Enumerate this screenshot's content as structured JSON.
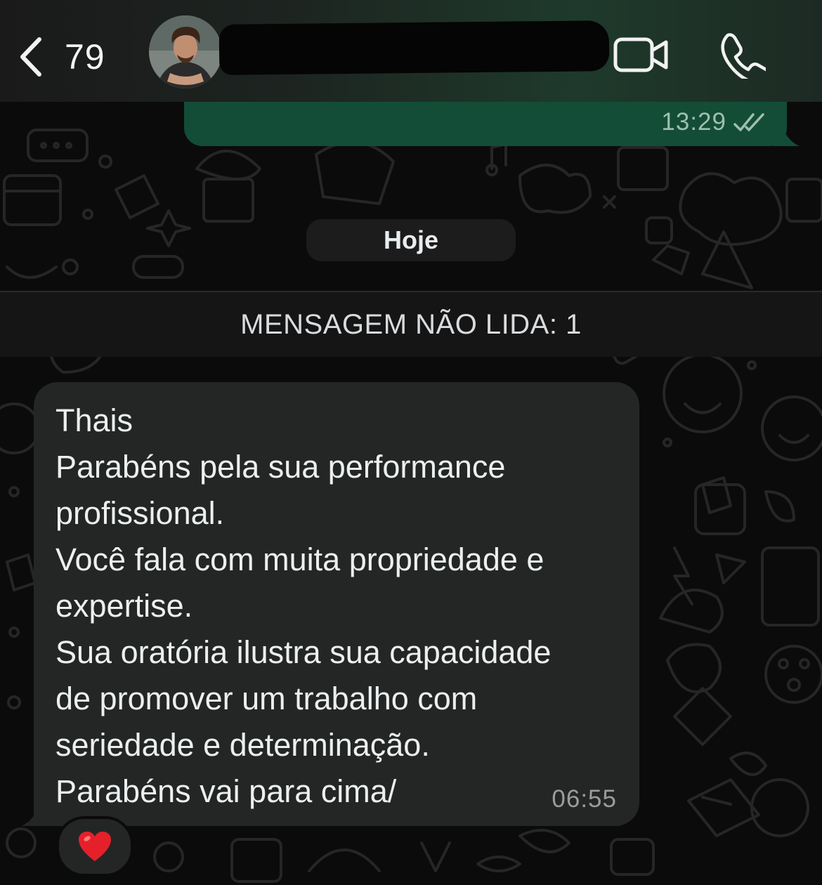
{
  "header": {
    "unread_count": "79",
    "contact_avatar": "contact-photo",
    "contact_name": "",
    "icons": {
      "back": "chevron-left-icon",
      "video": "video-camera-icon",
      "call": "phone-icon"
    }
  },
  "outgoing_message": {
    "time": "13:29",
    "status_icon": "double-check-icon"
  },
  "date_separator": "Hoje",
  "unread_banner": "MENSAGEM NÃO LIDA: 1",
  "incoming_message": {
    "lines": [
      "Thais",
      "Parabéns pela sua performance",
      "profissional.",
      "Você fala com muita propriedade e",
      "expertise.",
      "Sua oratória ilustra sua capacidade",
      "de promover um trabalho com",
      "seriedade e determinação.",
      "Parabéns vai para cima/"
    ],
    "time": "06:55",
    "reaction": "❤️"
  },
  "colors": {
    "background": "#0b0b0b",
    "outgoing_bubble": "#134d37",
    "incoming_bubble": "#242626",
    "header_accent": "#1e3a2c"
  }
}
